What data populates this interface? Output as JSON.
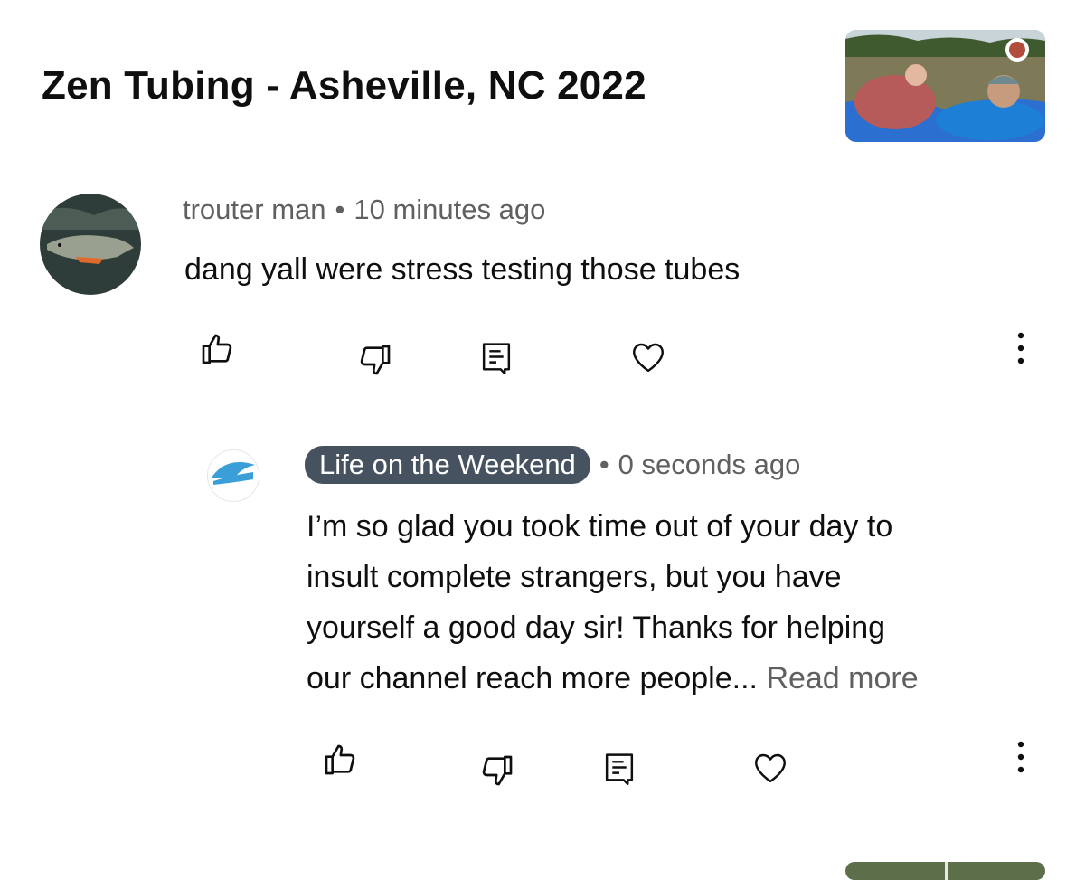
{
  "video": {
    "title": "Zen Tubing - Asheville, NC 2022"
  },
  "comment": {
    "author": "trouter man",
    "separator": "•",
    "time": "10 minutes ago",
    "text": "dang yall were stress testing those tubes"
  },
  "reply": {
    "author": "Life on the Weekend",
    "separator": "•",
    "time": "0 seconds ago",
    "text_lines": [
      "I’m so glad you took time out of your day to",
      "insult complete strangers, but you have",
      "yourself a good day sir! Thanks for helping",
      "our channel reach more people..."
    ],
    "read_more": "Read more"
  },
  "colors": {
    "chip_bg": "#465260",
    "meta_text": "#606060",
    "icon_stroke": "#0f0f0f"
  },
  "icons": [
    "thumbs-up-icon",
    "thumbs-down-icon",
    "reply-icon",
    "heart-icon",
    "more-vert-icon"
  ]
}
